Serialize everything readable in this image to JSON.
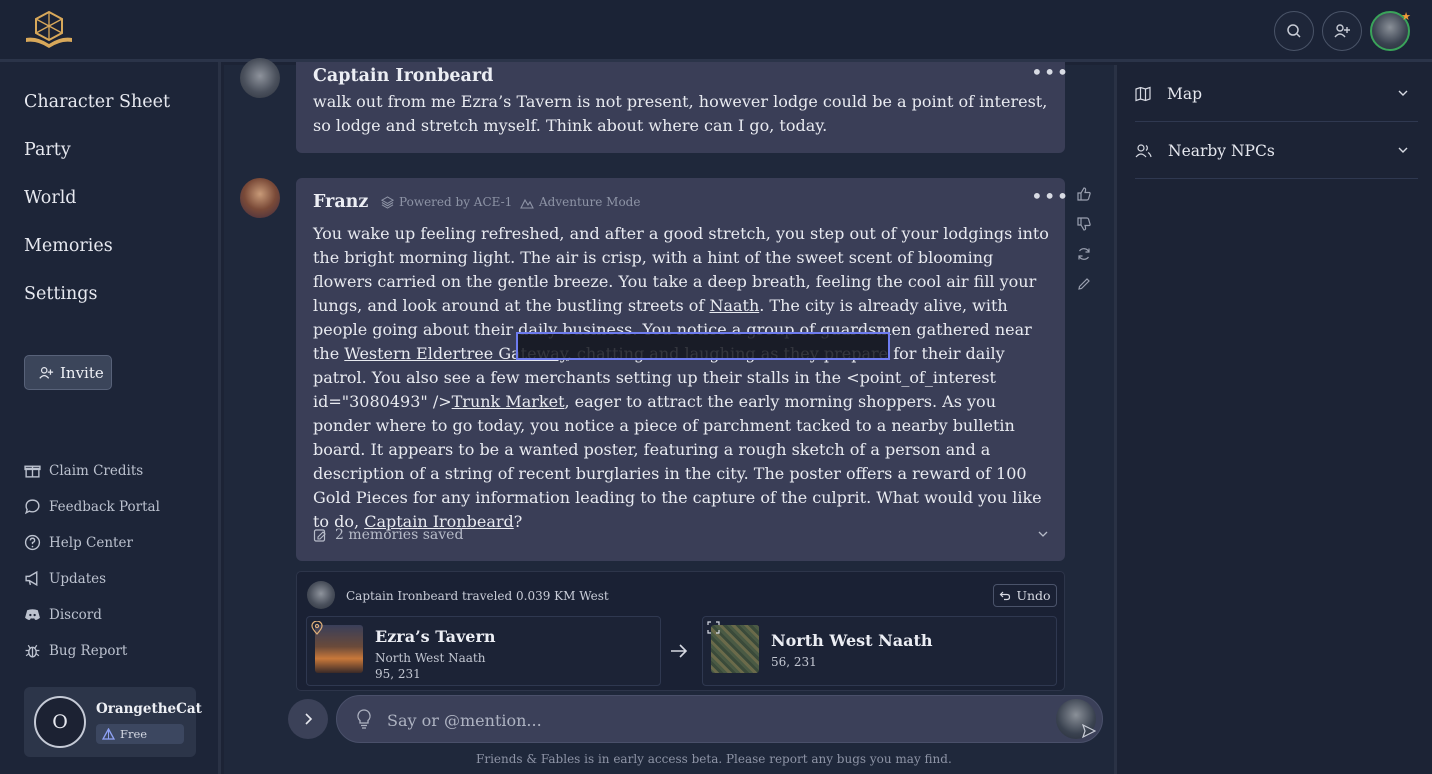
{
  "header": {
    "logo_icon": "d20-book-icon"
  },
  "sidebar": {
    "nav": [
      "Character Sheet",
      "Party",
      "World",
      "Memories",
      "Settings"
    ],
    "invite_label": "Invite",
    "links": [
      "Claim Credits",
      "Feedback Portal",
      "Help Center",
      "Updates",
      "Discord",
      "Bug Report"
    ],
    "user": {
      "initial": "O",
      "name": "OrangetheCat",
      "plan": "Free"
    }
  },
  "messages": [
    {
      "author": "Captain Ironbeard",
      "text": "walk out from me Ezra’s Tavern is not present, however lodge could be a point of interest, so lodge and stretch myself. Think about where can I go, today."
    },
    {
      "author": "Franz",
      "powered_by": "Powered by ACE-1",
      "mode": "Adventure Mode",
      "text_parts": [
        "You wake up feeling refreshed, and after a good stretch, you step out of your lodgings into the bright morning light. The air is crisp, with a hint of the sweet scent of blooming flowers carried on the gentle breeze. You take a deep breath, feeling the cool air fill your lungs, and look around at the bustling streets of ",
        "Naath",
        ". The city is already alive, with people going about their daily business. You notice a group of guardsmen gathered near the ",
        "Western Eldertree Gateway",
        ", chatting and laughing as they prepare for their daily patrol. You also see a few merchants setting up their stalls in the <point_of_interest id=\"3080493\" />",
        "Trunk Market",
        ", eager to attract the early morning shoppers. As you ponder where to go today, you notice a piece of parchment tacked to a nearby bulletin board. It appears to be a wanted poster, featuring a rough sketch of a person and a description of a string of recent burglaries in the city. The poster offers a reward of 100 Gold Pieces for any information leading to the capture of the culprit. What would you like to do, ",
        "Captain Ironbeard",
        "?"
      ],
      "memories": "2 memories saved"
    }
  ],
  "travel": {
    "summary": "Captain Ironbeard traveled 0.039 KM West",
    "undo_label": "Undo",
    "from": {
      "name": "Ezra’s Tavern",
      "area": "North West Naath",
      "coords": "95, 231"
    },
    "to": {
      "name": "North West Naath",
      "coords": "56, 231"
    }
  },
  "composer": {
    "placeholder": "Say or @mention..."
  },
  "footer": "Friends & Fables is in early access beta. Please report any bugs you may find.",
  "right_panel": {
    "sections": [
      "Map",
      "Nearby NPCs"
    ]
  },
  "colors": {
    "accent": "#6e7cf0",
    "online": "#3aa35a",
    "notify": "#f29c38"
  }
}
